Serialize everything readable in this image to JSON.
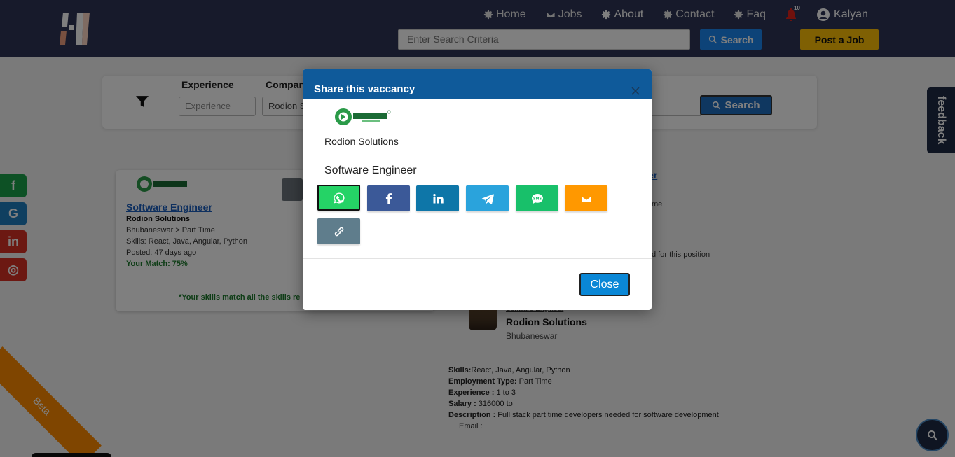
{
  "nav": {
    "home": "Home",
    "jobs": "Jobs",
    "about": "About",
    "contact": "Contact",
    "faq": "Faq",
    "notification_count": "10",
    "user_name": "Kalyan",
    "search_placeholder": "Enter Search Criteria",
    "search_label": "Search",
    "post_job_label": "Post a Job"
  },
  "filters": {
    "experience_label": "Experience",
    "experience_placeholder": "Experience",
    "company_label": "Company",
    "company_value": "Rodion S",
    "search_label": "Search"
  },
  "side_social": [
    "f",
    "G",
    "in",
    "◎"
  ],
  "feedback_label": "feedback",
  "job_card": {
    "title": "Software Engineer",
    "company": "Rodion Solutions",
    "location_type": "Bhubaneswar > Part Time",
    "skills": "Skills: React, Java, Angular, Python",
    "posted": "Posted: 47 days ago",
    "match": "Your Match: 75%",
    "match_note": "*Your skills match all the skills re"
  },
  "detail": {
    "title_fragment": "er",
    "type_fragment": "me",
    "needed_fragment": "d for this position",
    "company_sub": "Software Engineer",
    "company_name": "Rodion Solutions",
    "company_location": "Bhubaneswar",
    "skills_label": "Skills:",
    "skills_value": "React, Java, Angular, Python",
    "employment_label": "Employment Type:",
    "employment_value": " Part Time",
    "experience_label": "Experience :",
    "experience_value": " 1 to 3",
    "salary_label": "Salary :",
    "salary_value": " 316000 to",
    "description_label": "Description :",
    "description_value": "  Full stack part time developers needed for software development",
    "email_label": "Email :"
  },
  "beta_label": "Beta",
  "modal": {
    "title": "Share this vaccancy",
    "company": "Rodion Solutions",
    "job_title": "Software Engineer",
    "close_label": "Close",
    "share_buttons": [
      {
        "name": "whatsapp",
        "color": "#25d366"
      },
      {
        "name": "facebook",
        "color": "#3b5998"
      },
      {
        "name": "linkedin",
        "color": "#0e76a8"
      },
      {
        "name": "telegram",
        "color": "#2aa3dc"
      },
      {
        "name": "sms",
        "color": "#18c06a"
      },
      {
        "name": "email",
        "color": "#ff9800"
      },
      {
        "name": "copy-link",
        "color": "#5f7d8c"
      }
    ]
  },
  "colors": {
    "navbar": "#2e3456",
    "modal_header": "#0f5a9a",
    "accent_blue": "#1a86f0",
    "accent_yellow": "#ffc107"
  }
}
